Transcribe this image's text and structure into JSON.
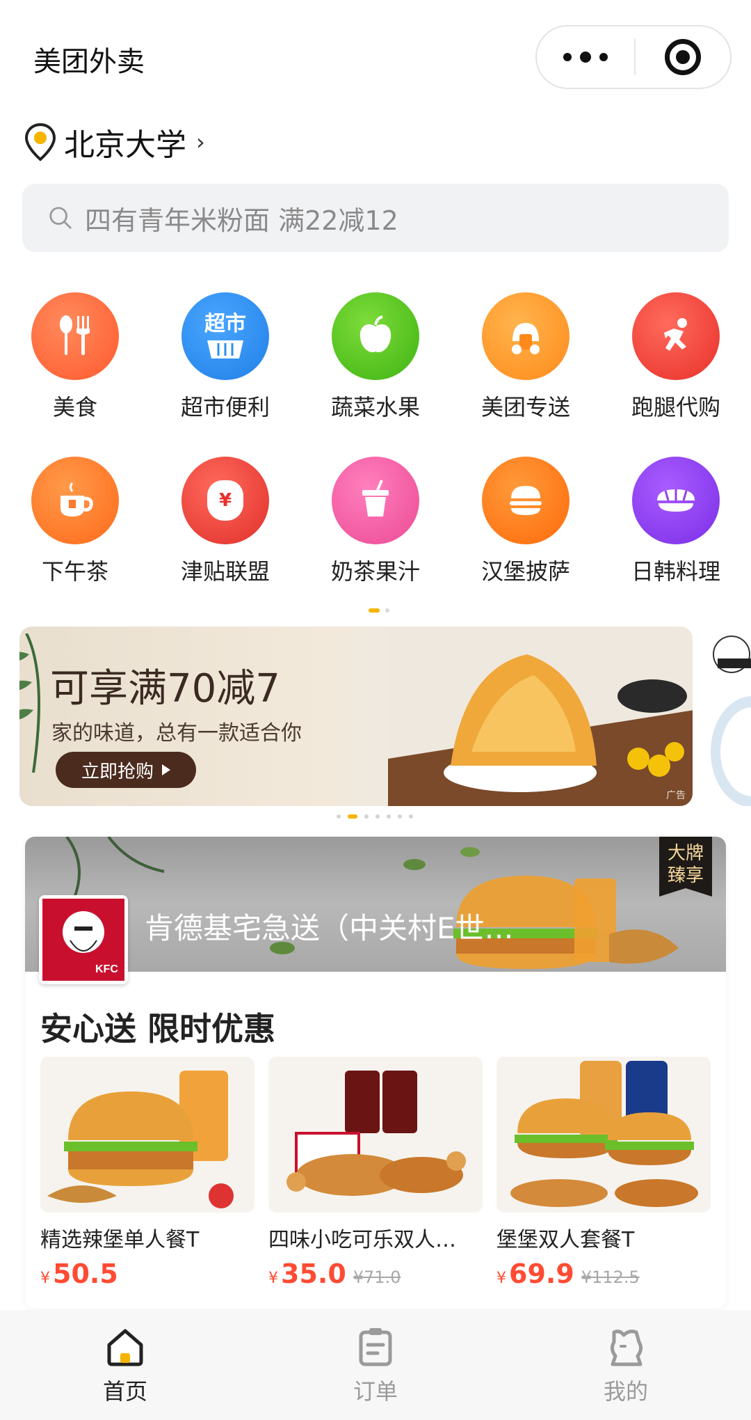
{
  "app": {
    "title": "美团外卖"
  },
  "location": {
    "name": "北京大学",
    "chevron": "›"
  },
  "search": {
    "placeholder": "四有青年米粉面 满22减12"
  },
  "categories": [
    {
      "label": "美食",
      "icon": "fork-spoon-icon",
      "color": "#ff6a3d"
    },
    {
      "label": "超市便利",
      "icon": "supermarket-basket-icon",
      "color": "#2b8ff0",
      "icon_text": "超市"
    },
    {
      "label": "蔬菜水果",
      "icon": "apple-icon",
      "color": "#52c41a"
    },
    {
      "label": "美团专送",
      "icon": "scooter-icon",
      "color": "#ff9a2e"
    },
    {
      "label": "跑腿代购",
      "icon": "runner-icon",
      "color": "#f5473b"
    },
    {
      "label": "下午茶",
      "icon": "tea-cup-icon",
      "color": "#ff7a2a"
    },
    {
      "label": "津贴联盟",
      "icon": "money-bag-icon",
      "color": "#f0433a",
      "icon_text": "¥"
    },
    {
      "label": "奶茶果汁",
      "icon": "drink-cup-icon",
      "color": "#f25aa0"
    },
    {
      "label": "汉堡披萨",
      "icon": "burger-icon",
      "color": "#ff7a1a"
    },
    {
      "label": "日韩料理",
      "icon": "sushi-icon",
      "color": "#8f3ff0"
    }
  ],
  "banner": {
    "title": "可享满70减7",
    "subtitle": "家的味道，总有一款适合你",
    "button": "立即抢购",
    "ad_label": "广告"
  },
  "store": {
    "name": "肯德基宅急送（中关村E世…",
    "logo_text": "KFC",
    "brand_tag": "大牌臻享",
    "section_title": "安心送 限时优惠",
    "products": [
      {
        "name": "精选辣堡单人餐T",
        "currency": "¥",
        "price": "50.5",
        "original": ""
      },
      {
        "name": "四味小吃可乐双人…",
        "currency": "¥",
        "price": "35.0",
        "original": "¥71.0"
      },
      {
        "name": "堡堡双人套餐T",
        "currency": "¥",
        "price": "69.9",
        "original": "¥112.5"
      }
    ]
  },
  "tabs": [
    {
      "label": "首页",
      "icon": "home-icon",
      "active": true
    },
    {
      "label": "订单",
      "icon": "order-clipboard-icon",
      "active": false
    },
    {
      "label": "我的",
      "icon": "profile-icon",
      "active": false
    }
  ]
}
